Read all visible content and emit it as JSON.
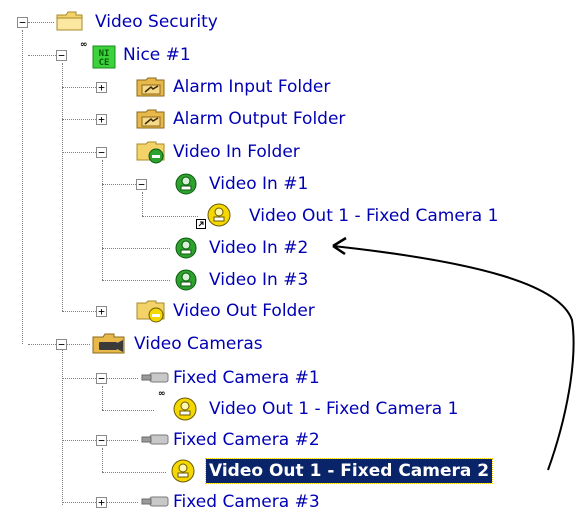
{
  "tree": {
    "root_label": "Video Security",
    "nice_label": "Nice #1",
    "nice_icon_text": "NI CE",
    "alarm_input_label": "Alarm Input Folder",
    "alarm_output_label": "Alarm Output Folder",
    "video_in_folder_label": "Video In Folder",
    "video_in_1_label": "Video In #1",
    "video_out_fc1_label_a": "Video Out 1 - Fixed Camera 1",
    "video_in_2_label": "Video In #2",
    "video_in_3_label": "Video In #3",
    "video_out_folder_label": "Video Out Folder",
    "video_cameras_label": "Video Cameras",
    "fixed_camera_1_label": "Fixed Camera #1",
    "video_out_fc1_label_b": "Video Out 1 - Fixed Camera 1",
    "fixed_camera_2_label": "Fixed Camera #2",
    "video_out_fc2_label": "Video Out 1 - Fixed Camera 2",
    "fixed_camera_3_label": "Fixed Camera #3",
    "expand_symbol": "+",
    "collapse_symbol": "−"
  },
  "colors": {
    "text": "#0000b4",
    "selection_bg": "#0a246a",
    "selection_text": "#ffffff",
    "folder": "#f4d26a",
    "green_ball": "#2ea22e",
    "yellow_ball": "#f5d800",
    "nice_green": "#3cd23c"
  }
}
